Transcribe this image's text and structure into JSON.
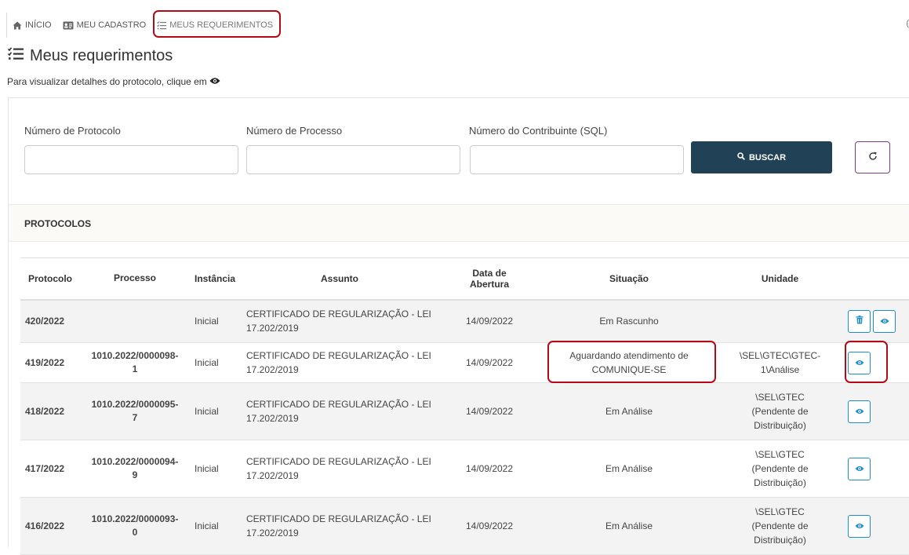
{
  "nav": {
    "items": [
      {
        "label": "INÍCIO",
        "icon": "home-icon"
      },
      {
        "label": "MEU CADASTRO",
        "icon": "id-card-icon"
      },
      {
        "label": "MEUS REQUERIMENTOS",
        "icon": "list-check-icon"
      }
    ],
    "overflow_text": "("
  },
  "page": {
    "title": "Meus requerimentos",
    "hint": "Para visualizar detalhes do protocolo, clique em"
  },
  "filters": {
    "protocolo_label": "Número de Protocolo",
    "processo_label": "Número de Processo",
    "contribuinte_label": "Número do Contribuinte (SQL)",
    "protocolo_value": "",
    "processo_value": "",
    "contribuinte_value": "",
    "buscar_label": "BUSCAR"
  },
  "section": {
    "title": "PROTOCOLOS"
  },
  "table": {
    "headers": {
      "protocolo": "Protocolo",
      "processo": "Processo",
      "instancia": "Instância",
      "assunto": "Assunto",
      "data_l1": "Data de",
      "data_l2": "Abertura",
      "situacao": "Situação",
      "unidade": "Unidade"
    },
    "rows": [
      {
        "protocolo": "420/2022",
        "processo_l1": "",
        "processo_l2": "",
        "instancia": "Inicial",
        "assunto_l1": "CERTIFICADO DE REGULARIZAÇÃO - LEI",
        "assunto_l2": "17.202/2019",
        "data": "14/09/2022",
        "situacao_l1": "Em Rascunho",
        "situacao_l2": "",
        "unidade_l1": "",
        "unidade_l2": "",
        "unidade_l3": ""
      },
      {
        "protocolo": "419/2022",
        "processo_l1": "1010.2022/0000098-",
        "processo_l2": "1",
        "instancia": "Inicial",
        "assunto_l1": "CERTIFICADO DE REGULARIZAÇÃO - LEI",
        "assunto_l2": "17.202/2019",
        "data": "14/09/2022",
        "situacao_l1": "Aguardando atendimento de",
        "situacao_l2": "COMUNIQUE-SE",
        "unidade_l1": "\\SEL\\GTEC\\GTEC-",
        "unidade_l2": "1\\Análise",
        "unidade_l3": ""
      },
      {
        "protocolo": "418/2022",
        "processo_l1": "1010.2022/0000095-",
        "processo_l2": "7",
        "instancia": "Inicial",
        "assunto_l1": "CERTIFICADO DE REGULARIZAÇÃO - LEI",
        "assunto_l2": "17.202/2019",
        "data": "14/09/2022",
        "situacao_l1": "Em Análise",
        "situacao_l2": "",
        "unidade_l1": "\\SEL\\GTEC",
        "unidade_l2": "(Pendente de",
        "unidade_l3": "Distribuição)"
      },
      {
        "protocolo": "417/2022",
        "processo_l1": "1010.2022/0000094-",
        "processo_l2": "9",
        "instancia": "Inicial",
        "assunto_l1": "CERTIFICADO DE REGULARIZAÇÃO - LEI",
        "assunto_l2": "17.202/2019",
        "data": "14/09/2022",
        "situacao_l1": "Em Análise",
        "situacao_l2": "",
        "unidade_l1": "\\SEL\\GTEC",
        "unidade_l2": "(Pendente de",
        "unidade_l3": "Distribuição)"
      },
      {
        "protocolo": "416/2022",
        "processo_l1": "1010.2022/0000093-",
        "processo_l2": "0",
        "instancia": "Inicial",
        "assunto_l1": "CERTIFICADO DE REGULARIZAÇÃO - LEI",
        "assunto_l2": "17.202/2019",
        "data": "14/09/2022",
        "situacao_l1": "Em Análise",
        "situacao_l2": "",
        "unidade_l1": "\\SEL\\GTEC",
        "unidade_l2": "(Pendente de",
        "unidade_l3": "Distribuição)"
      }
    ]
  },
  "colors": {
    "primary_button": "#214256",
    "action_border": "#1e8ec7",
    "highlight": "#b30b16",
    "refresh_border": "#7a3d84"
  }
}
